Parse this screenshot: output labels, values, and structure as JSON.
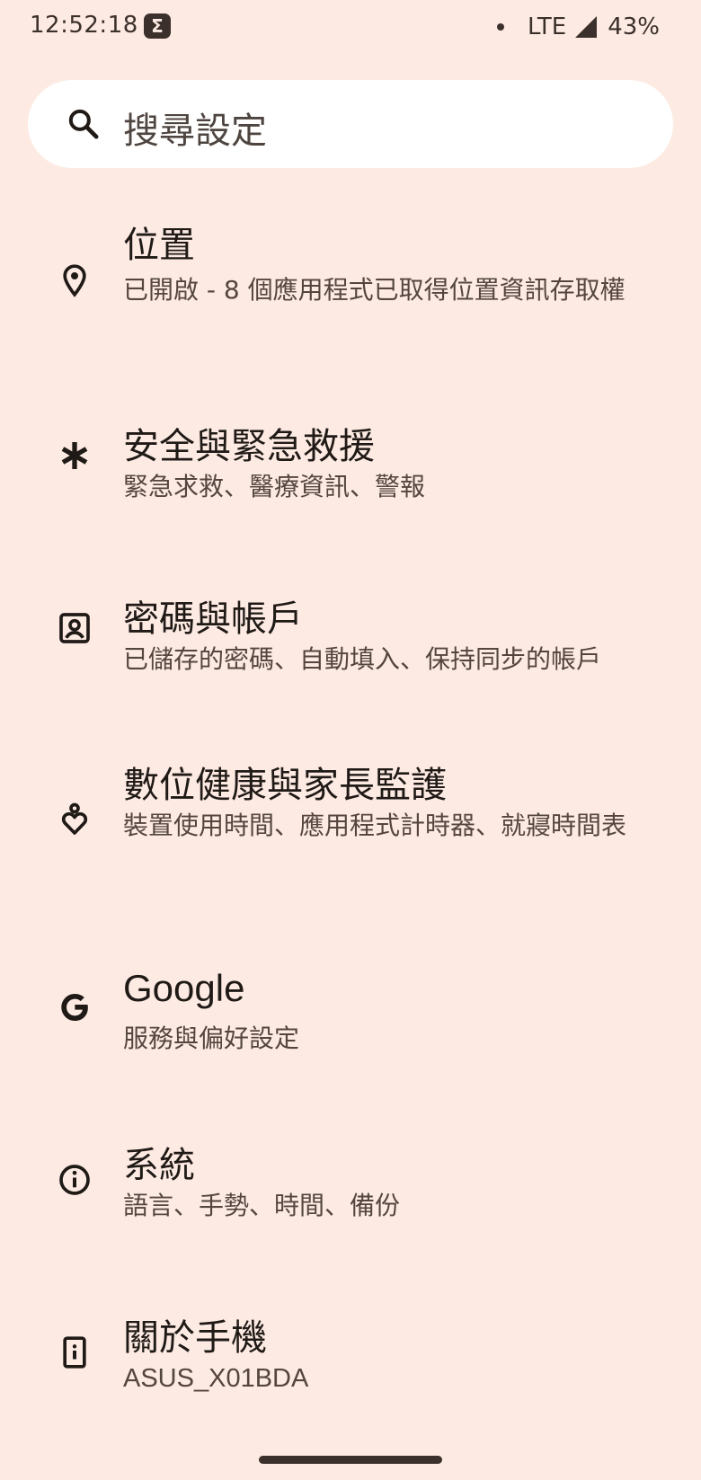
{
  "status_bar": {
    "time": "12:52:18",
    "app_icon": "Σ",
    "network": "LTE",
    "battery": "43%"
  },
  "search": {
    "placeholder": "搜尋設定",
    "icon": "search-icon"
  },
  "settings": [
    {
      "id": "location",
      "icon": "location-pin-icon",
      "title": "位置",
      "subtitle": "已開啟 - 8 個應用程式已取得位置資訊存取權"
    },
    {
      "id": "safety",
      "icon": "asterisk-icon",
      "title": "安全與緊急救援",
      "subtitle": "緊急求救、醫療資訊、警報"
    },
    {
      "id": "passwords",
      "icon": "account-box-icon",
      "title": "密碼與帳戶",
      "subtitle": "已儲存的密碼、自動填入、保持同步的帳戶"
    },
    {
      "id": "wellbeing",
      "icon": "wellbeing-icon",
      "title": "數位健康與家長監護",
      "subtitle": "裝置使用時間、應用程式計時器、就寢時間表"
    },
    {
      "id": "google",
      "icon": "google-g-icon",
      "title": "Google",
      "subtitle": "服務與偏好設定"
    },
    {
      "id": "system",
      "icon": "info-icon",
      "title": "系統",
      "subtitle": "語言、手勢、時間、備份"
    },
    {
      "id": "about",
      "icon": "phone-info-icon",
      "title": "關於手機",
      "subtitle": "ASUS_X01BDA"
    }
  ],
  "colors": {
    "background": "#fdebe3",
    "search_background": "#ffffff",
    "text_primary": "#201a17",
    "text_secondary": "#54453f"
  }
}
